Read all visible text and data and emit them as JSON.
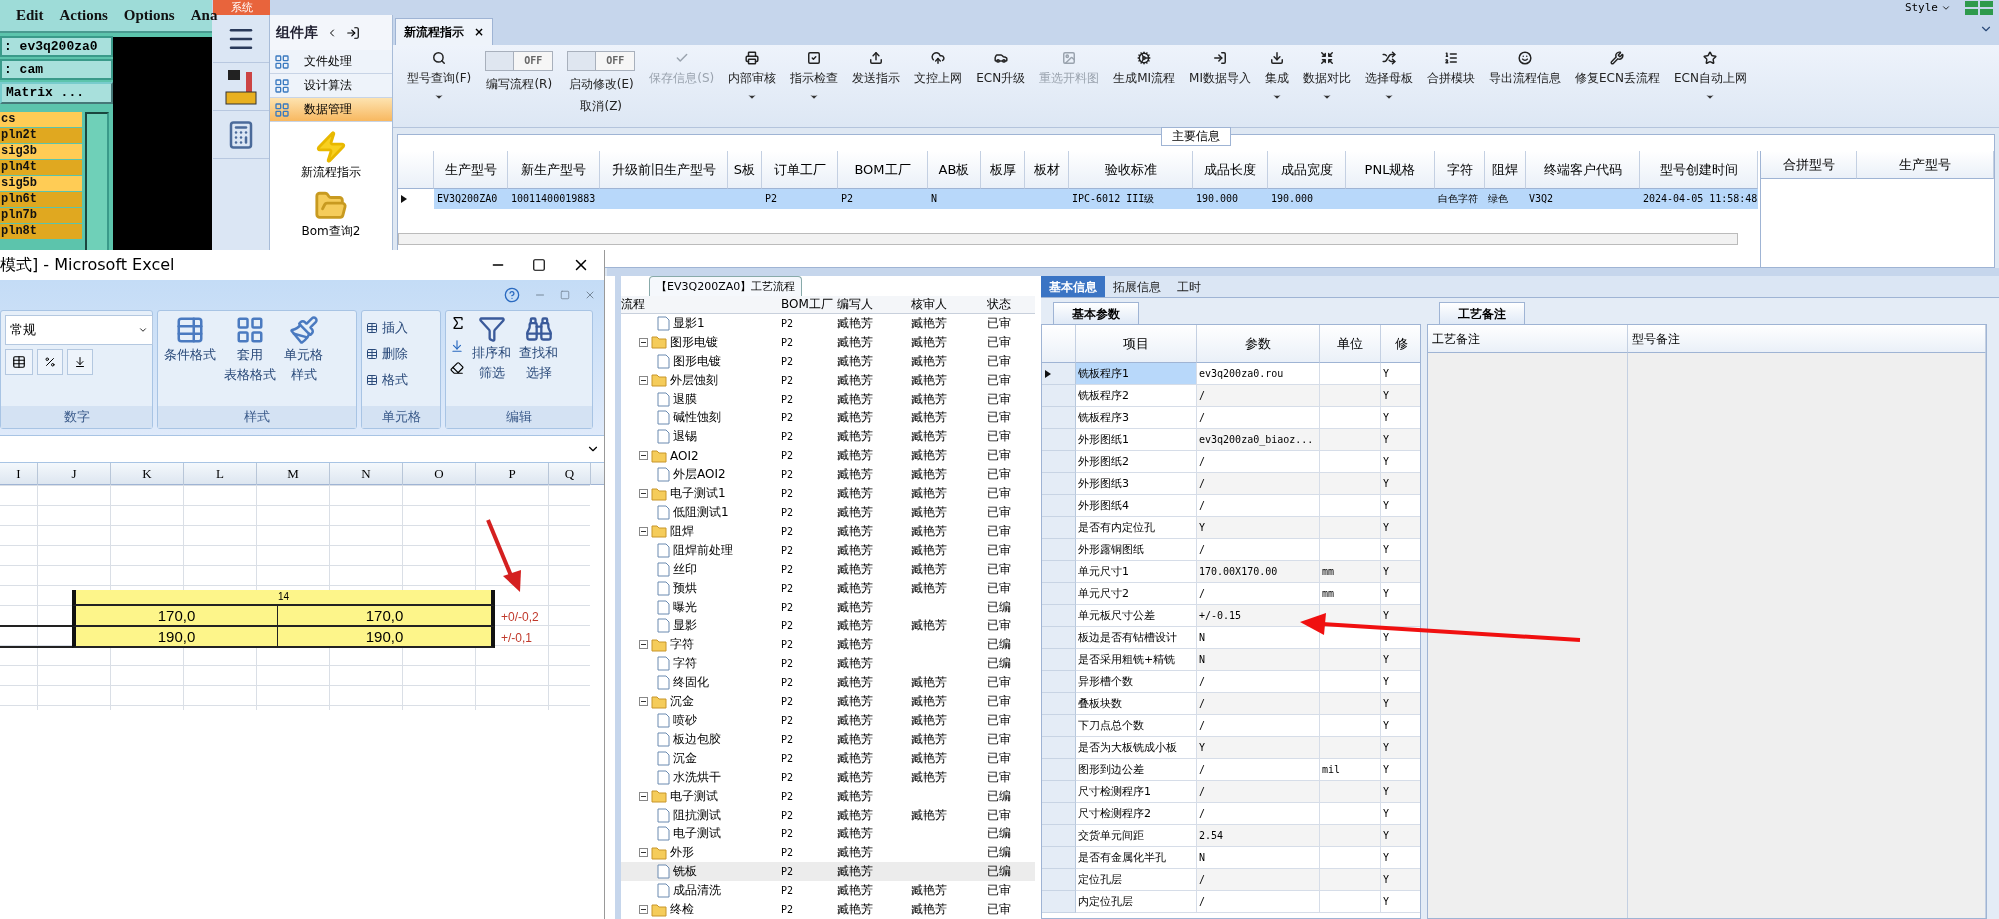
{
  "cam": {
    "menu": [
      "Edit",
      "Actions",
      "Options",
      "Ana"
    ],
    "job_field": ": ev3q200za0",
    "step_field": ": cam",
    "matrix_button": "Matrix ...",
    "layers": [
      {
        "name": "cs",
        "color": "#ffcc55"
      },
      {
        "name": "pln2t",
        "color": "#e0a820"
      },
      {
        "name": "sig3b",
        "color": "#ffcc55"
      },
      {
        "name": "pln4t",
        "color": "#e0a820"
      },
      {
        "name": "sig5b",
        "color": "#ffcc55"
      },
      {
        "name": "pln6t",
        "color": "#e0a820"
      },
      {
        "name": "pln7b",
        "color": "#e0a820"
      },
      {
        "name": "pln8t",
        "color": "#e0a820"
      }
    ]
  },
  "app": {
    "system_tab": "系统",
    "style_menu": "Style",
    "panel_title": "组件库",
    "nav_items": [
      {
        "label": "文件处理",
        "selected": false
      },
      {
        "label": "设计算法",
        "selected": false
      },
      {
        "label": "数据管理",
        "selected": true
      }
    ],
    "tiles": [
      "新流程指示",
      "Bom查询2"
    ],
    "doc_tab": {
      "label": "新流程指示",
      "close": "×"
    },
    "toolbar": [
      {
        "kind": "button",
        "label": "型号查询(F)",
        "dropdown": true,
        "disabled": false
      },
      {
        "kind": "toggle",
        "label": "编写流程(R)",
        "switch_text": "OFF",
        "on": false
      },
      {
        "kind": "toggle",
        "label": "启动修改(E)",
        "sublabel": "取消(Z)",
        "switch_text": "OFF",
        "on": false
      },
      {
        "kind": "button",
        "label": "保存信息(S)",
        "dropdown": false,
        "disabled": true
      },
      {
        "kind": "button",
        "label": "内部审核",
        "dropdown": true,
        "disabled": false
      },
      {
        "kind": "button",
        "label": "指示检查",
        "dropdown": true,
        "disabled": false
      },
      {
        "kind": "button",
        "label": "发送指示",
        "dropdown": false,
        "disabled": false
      },
      {
        "kind": "button",
        "label": "文控上网",
        "dropdown": false,
        "disabled": false
      },
      {
        "kind": "button",
        "label": "ECN升级",
        "dropdown": false,
        "disabled": false
      },
      {
        "kind": "button",
        "label": "重选开料图",
        "dropdown": false,
        "disabled": true
      },
      {
        "kind": "button",
        "label": "生成MI流程",
        "dropdown": false,
        "disabled": false
      },
      {
        "kind": "button",
        "label": "MI数据导入",
        "dropdown": false,
        "disabled": false
      },
      {
        "kind": "button",
        "label": "集成",
        "dropdown": true,
        "disabled": false
      },
      {
        "kind": "button",
        "label": "数据对比",
        "dropdown": true,
        "disabled": false
      },
      {
        "kind": "button",
        "label": "选择母板",
        "dropdown": true,
        "disabled": false
      },
      {
        "kind": "button",
        "label": "合拼模块",
        "dropdown": false,
        "disabled": false
      },
      {
        "kind": "button",
        "label": "导出流程信息",
        "dropdown": false,
        "disabled": false
      },
      {
        "kind": "button",
        "label": "修复ECN丢流程",
        "dropdown": false,
        "disabled": false
      },
      {
        "kind": "button",
        "label": "ECN自动上网",
        "dropdown": true,
        "disabled": false
      }
    ],
    "main_info": {
      "title": "主要信息",
      "columns": [
        "生产型号",
        "新生产型号",
        "升级前旧生产型号",
        "S板",
        "订单工厂",
        "BOM工厂",
        "AB板",
        "板厚",
        "板材",
        "验收标准",
        "成品长度",
        "成品宽度",
        "PNL规格",
        "字符",
        "阻焊",
        "终端客户代码",
        "型号创建时间"
      ],
      "rows": [
        {
          "selected": true,
          "cells": [
            "EV3Q200ZA0",
            "10011400019883",
            "",
            "",
            "P2",
            "P2",
            "N",
            "",
            "",
            "IPC-6012 III级",
            "190.000",
            "190.000",
            "",
            "白色字符",
            "绿色",
            "V3Q2",
            "2024-04-05 11:58:48"
          ]
        }
      ],
      "side_columns": [
        "合拼型号",
        "生产型号"
      ]
    },
    "process": {
      "title": "【EV3Q200ZA0】工艺流程",
      "columns": [
        "流程",
        "BOM工厂",
        "编写人",
        "核审人",
        "状态"
      ],
      "groups": [
        {
          "children": [
            {
              "name": "显影1",
              "bom": "P2",
              "writer": "臧艳芳",
              "reviewer": "臧艳芳",
              "status": "已审",
              "selected": false
            }
          ]
        },
        {
          "name": "图形电镀",
          "bom": "P2",
          "writer": "臧艳芳",
          "reviewer": "臧艳芳",
          "status": "已审",
          "expanded": true,
          "selected": false,
          "children": [
            {
              "name": "图形电镀",
              "bom": "P2",
              "writer": "臧艳芳",
              "reviewer": "臧艳芳",
              "status": "已审",
              "selected": false
            }
          ]
        },
        {
          "name": "外层蚀刻",
          "bom": "P2",
          "writer": "臧艳芳",
          "reviewer": "臧艳芳",
          "status": "已审",
          "expanded": true,
          "selected": false,
          "children": [
            {
              "name": "退膜",
              "bom": "P2",
              "writer": "臧艳芳",
              "reviewer": "臧艳芳",
              "status": "已审",
              "selected": false
            },
            {
              "name": "碱性蚀刻",
              "bom": "P2",
              "writer": "臧艳芳",
              "reviewer": "臧艳芳",
              "status": "已审",
              "selected": false
            },
            {
              "name": "退锡",
              "bom": "P2",
              "writer": "臧艳芳",
              "reviewer": "臧艳芳",
              "status": "已审",
              "selected": false
            }
          ]
        },
        {
          "name": "AOI2",
          "bom": "P2",
          "writer": "臧艳芳",
          "reviewer": "臧艳芳",
          "status": "已审",
          "expanded": true,
          "selected": false,
          "children": [
            {
              "name": "外层AOI2",
              "bom": "P2",
              "writer": "臧艳芳",
              "reviewer": "臧艳芳",
              "status": "已审",
              "selected": false
            }
          ]
        },
        {
          "name": "电子测试1",
          "bom": "P2",
          "writer": "臧艳芳",
          "reviewer": "臧艳芳",
          "status": "已审",
          "expanded": true,
          "selected": false,
          "children": [
            {
              "name": "低阻测试1",
              "bom": "P2",
              "writer": "臧艳芳",
              "reviewer": "臧艳芳",
              "status": "已审",
              "selected": false
            }
          ]
        },
        {
          "name": "阻焊",
          "bom": "P2",
          "writer": "臧艳芳",
          "reviewer": "臧艳芳",
          "status": "已审",
          "expanded": true,
          "selected": false,
          "children": [
            {
              "name": "阻焊前处理",
              "bom": "P2",
              "writer": "臧艳芳",
              "reviewer": "臧艳芳",
              "status": "已审",
              "selected": false
            },
            {
              "name": "丝印",
              "bom": "P2",
              "writer": "臧艳芳",
              "reviewer": "臧艳芳",
              "status": "已审",
              "selected": false
            },
            {
              "name": "预烘",
              "bom": "P2",
              "writer": "臧艳芳",
              "reviewer": "臧艳芳",
              "status": "已审",
              "selected": false
            },
            {
              "name": "曝光",
              "bom": "P2",
              "writer": "臧艳芳",
              "status": "已编",
              "selected": false
            },
            {
              "name": "显影",
              "bom": "P2",
              "writer": "臧艳芳",
              "reviewer": "臧艳芳",
              "status": "已审",
              "selected": false
            }
          ]
        },
        {
          "name": "字符",
          "bom": "P2",
          "writer": "臧艳芳",
          "status": "已编",
          "expanded": true,
          "selected": false,
          "children": [
            {
              "name": "字符",
              "bom": "P2",
              "writer": "臧艳芳",
              "status": "已编",
              "selected": false
            },
            {
              "name": "终固化",
              "bom": "P2",
              "writer": "臧艳芳",
              "reviewer": "臧艳芳",
              "status": "已审",
              "selected": false
            }
          ]
        },
        {
          "name": "沉金",
          "bom": "P2",
          "writer": "臧艳芳",
          "reviewer": "臧艳芳",
          "status": "已审",
          "expanded": true,
          "selected": false,
          "children": [
            {
              "name": "喷砂",
              "bom": "P2",
              "writer": "臧艳芳",
              "reviewer": "臧艳芳",
              "status": "已审",
              "selected": false
            },
            {
              "name": "板边包胶",
              "bom": "P2",
              "writer": "臧艳芳",
              "reviewer": "臧艳芳",
              "status": "已审",
              "selected": false
            },
            {
              "name": "沉金",
              "bom": "P2",
              "writer": "臧艳芳",
              "reviewer": "臧艳芳",
              "status": "已审",
              "selected": false
            },
            {
              "name": "水洗烘干",
              "bom": "P2",
              "writer": "臧艳芳",
              "reviewer": "臧艳芳",
              "status": "已审",
              "selected": false
            }
          ]
        },
        {
          "name": "电子测试",
          "bom": "P2",
          "writer": "臧艳芳",
          "status": "已编",
          "expanded": true,
          "selected": false,
          "children": [
            {
              "name": "阻抗测试",
              "bom": "P2",
              "writer": "臧艳芳",
              "reviewer": "臧艳芳",
              "status": "已审",
              "selected": false
            },
            {
              "name": "电子测试",
              "bom": "P2",
              "writer": "臧艳芳",
              "status": "已编",
              "selected": false
            }
          ]
        },
        {
          "name": "外形",
          "bom": "P2",
          "writer": "臧艳芳",
          "status": "已编",
          "expanded": true,
          "selected": false,
          "children": [
            {
              "name": "铣板",
              "bom": "P2",
              "writer": "臧艳芳",
              "status": "已编",
              "selected": true
            },
            {
              "name": "成品清洗",
              "bom": "P2",
              "writer": "臧艳芳",
              "reviewer": "臧艳芳",
              "status": "已审",
              "selected": false
            }
          ]
        },
        {
          "name": "终检",
          "bom": "P2",
          "writer": "臧艳芳",
          "reviewer": "臧艳芳",
          "status": "已审",
          "expanded": true,
          "selected": false
        }
      ]
    },
    "detail": {
      "tabs": [
        {
          "label": "基本信息",
          "selected": true
        },
        {
          "label": "拓展信息",
          "selected": false
        },
        {
          "label": "工时",
          "selected": false
        }
      ],
      "params_tab": "基本参数",
      "columns": [
        "项目",
        "参数",
        "单位",
        "修"
      ],
      "rows": [
        {
          "item": "铣板程序1",
          "value": "ev3q200za0.rou",
          "unit": "",
          "mod": "Y",
          "selected": true
        },
        {
          "item": "铣板程序2",
          "value": "/",
          "unit": "",
          "mod": "Y",
          "selected": false
        },
        {
          "item": "铣板程序3",
          "value": "/",
          "unit": "",
          "mod": "Y",
          "selected": false
        },
        {
          "item": "外形图纸1",
          "value": "ev3q200za0_biaoz...",
          "unit": "",
          "mod": "Y",
          "selected": false
        },
        {
          "item": "外形图纸2",
          "value": "/",
          "unit": "",
          "mod": "Y",
          "selected": false
        },
        {
          "item": "外形图纸3",
          "value": "/",
          "unit": "",
          "mod": "Y",
          "selected": false
        },
        {
          "item": "外形图纸4",
          "value": "/",
          "unit": "",
          "mod": "Y",
          "selected": false
        },
        {
          "item": "是否有内定位孔",
          "value": "Y",
          "unit": "",
          "mod": "Y",
          "selected": false
        },
        {
          "item": "外形露铜图纸",
          "value": "/",
          "unit": "",
          "mod": "Y",
          "selected": false
        },
        {
          "item": "单元尺寸1",
          "value": "170.00X170.00",
          "unit": "mm",
          "mod": "Y",
          "selected": false
        },
        {
          "item": "单元尺寸2",
          "value": "/",
          "unit": "mm",
          "mod": "Y",
          "selected": false
        },
        {
          "item": "单元板尺寸公差",
          "value": "+/-0.15",
          "unit": "",
          "mod": "Y",
          "selected": false
        },
        {
          "item": "板边是否有钻槽设计",
          "value": "N",
          "unit": "",
          "mod": "Y",
          "selected": false
        },
        {
          "item": "是否采用粗铣+精铣",
          "value": "N",
          "unit": "",
          "mod": "Y",
          "selected": false
        },
        {
          "item": "异形槽个数",
          "value": "/",
          "unit": "",
          "mod": "Y",
          "selected": false
        },
        {
          "item": "叠板块数",
          "value": "/",
          "unit": "",
          "mod": "Y",
          "selected": false
        },
        {
          "item": "下刀点总个数",
          "value": "/",
          "unit": "",
          "mod": "Y",
          "selected": false
        },
        {
          "item": "是否为大板铣成小板",
          "value": "Y",
          "unit": "",
          "mod": "Y",
          "selected": false
        },
        {
          "item": "图形到边公差",
          "value": "/",
          "unit": "mil",
          "mod": "Y",
          "selected": false
        },
        {
          "item": "尺寸检测程序1",
          "value": "/",
          "unit": "",
          "mod": "Y",
          "selected": false
        },
        {
          "item": "尺寸检测程序2",
          "value": "/",
          "unit": "",
          "mod": "Y",
          "selected": false
        },
        {
          "item": "交货单元间距",
          "value": "2.54",
          "unit": "",
          "mod": "Y",
          "selected": false
        },
        {
          "item": "是否有金属化半孔",
          "value": "N",
          "unit": "",
          "mod": "Y",
          "selected": false
        },
        {
          "item": "定位孔层",
          "value": "/",
          "unit": "",
          "mod": "Y",
          "selected": false
        },
        {
          "item": "内定位孔层",
          "value": "/",
          "unit": "",
          "mod": "Y",
          "selected": false
        }
      ],
      "notes_tab": "工艺备注",
      "notes_columns": [
        "工艺备注",
        "型号备注"
      ]
    }
  },
  "excel": {
    "title": "模式] - Microsoft Excel",
    "number_format": "常规",
    "groups": [
      {
        "label": "数字"
      },
      {
        "label": "样式",
        "buttons": [
          [
            "条件格式"
          ],
          [
            "套用",
            "表格格式"
          ],
          [
            "单元格",
            "样式"
          ]
        ]
      },
      {
        "label": "单元格",
        "buttons": [
          [
            "插入"
          ],
          [
            "删除"
          ],
          [
            "格式"
          ]
        ]
      },
      {
        "label": "编辑",
        "buttons": [
          [
            "排序和",
            "筛选"
          ],
          [
            "查找和",
            "选择"
          ]
        ]
      }
    ],
    "columns": [
      "I",
      "J",
      "K",
      "L",
      "M",
      "N",
      "O",
      "P",
      "Q"
    ],
    "header_cell": "14",
    "rows": [
      {
        "values": [
          "170,0",
          "170,0"
        ],
        "note": "+0/-0,2"
      },
      {
        "values": [
          "190,0",
          "190,0"
        ],
        "note": "+/-0,1"
      }
    ]
  }
}
